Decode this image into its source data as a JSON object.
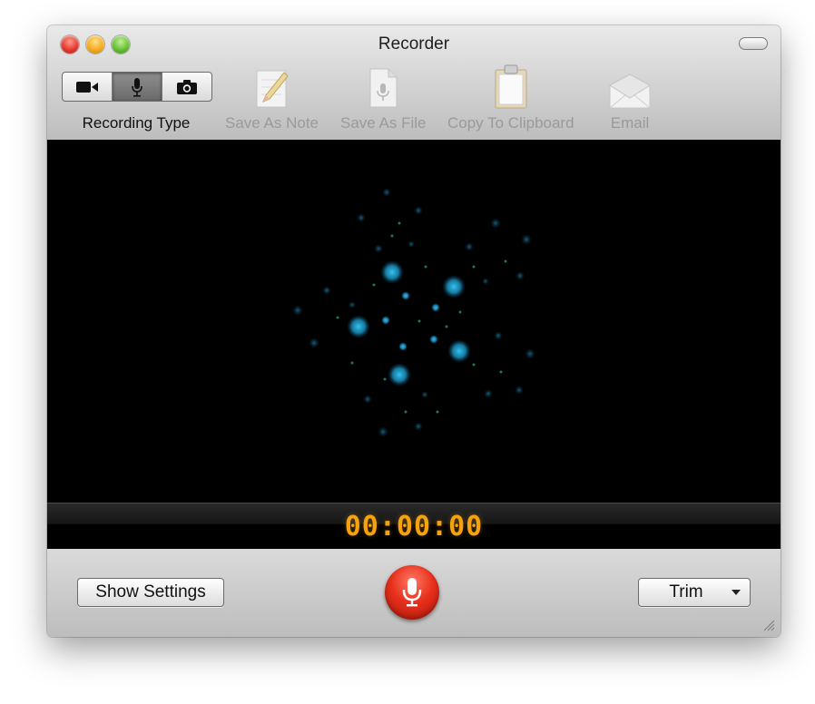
{
  "window": {
    "title": "Recorder"
  },
  "toolbar": {
    "recording_type_label": "Recording Type",
    "recording_types": [
      {
        "icon": "video-camera-icon",
        "active": false
      },
      {
        "icon": "microphone-icon",
        "active": true
      },
      {
        "icon": "camera-icon",
        "active": false
      }
    ],
    "tools": [
      {
        "label": "Save As Note",
        "icon": "note-pencil-icon",
        "enabled": false
      },
      {
        "label": "Save As File",
        "icon": "audio-file-icon",
        "enabled": false
      },
      {
        "label": "Copy To Clipboard",
        "icon": "clipboard-icon",
        "enabled": false
      },
      {
        "label": "Email",
        "icon": "envelope-icon",
        "enabled": false
      }
    ]
  },
  "visualizer": {
    "accent": "#1aa0c8"
  },
  "timer": {
    "value": "00:00:00",
    "color": "#f4a20e"
  },
  "controls": {
    "show_settings_label": "Show Settings",
    "record_button": {
      "icon": "microphone-icon",
      "color": "#e8301c"
    },
    "trim_label": "Trim"
  }
}
